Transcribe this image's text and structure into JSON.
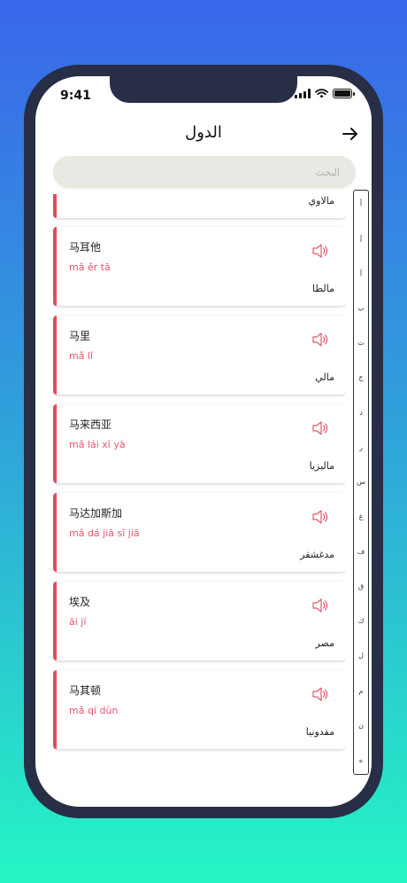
{
  "status_bar": {
    "time": "9:41"
  },
  "header": {
    "title": "الدول"
  },
  "search": {
    "placeholder": "البحث"
  },
  "countries": [
    {
      "hanzi": "",
      "pinyin": "",
      "arabic": "مالاوي"
    },
    {
      "hanzi": "马耳他",
      "pinyin": "mǎ ěr tā",
      "arabic": "مالطا"
    },
    {
      "hanzi": "马里",
      "pinyin": "mǎ lǐ",
      "arabic": "مالي"
    },
    {
      "hanzi": "马来西亚",
      "pinyin": "mǎ lái xī yà",
      "arabic": "ماليزيا"
    },
    {
      "hanzi": "马达加斯加",
      "pinyin": "mǎ dá jiā sī jiā",
      "arabic": "مدغشقر"
    },
    {
      "hanzi": "埃及",
      "pinyin": "āi jí",
      "arabic": "مصر"
    },
    {
      "hanzi": "马其顿",
      "pinyin": "mǎ qí dùn",
      "arabic": "مقدونيا"
    }
  ],
  "alphabet_index": [
    "أ",
    "إ",
    "آ",
    "ب",
    "ت",
    "ج",
    "د",
    "ر",
    "س",
    "غ",
    "ف",
    "ق",
    "ك",
    "ل",
    "م",
    "ن",
    "ه"
  ],
  "colors": {
    "accent": "#e54a5f",
    "pinyin": "#e3566c"
  }
}
